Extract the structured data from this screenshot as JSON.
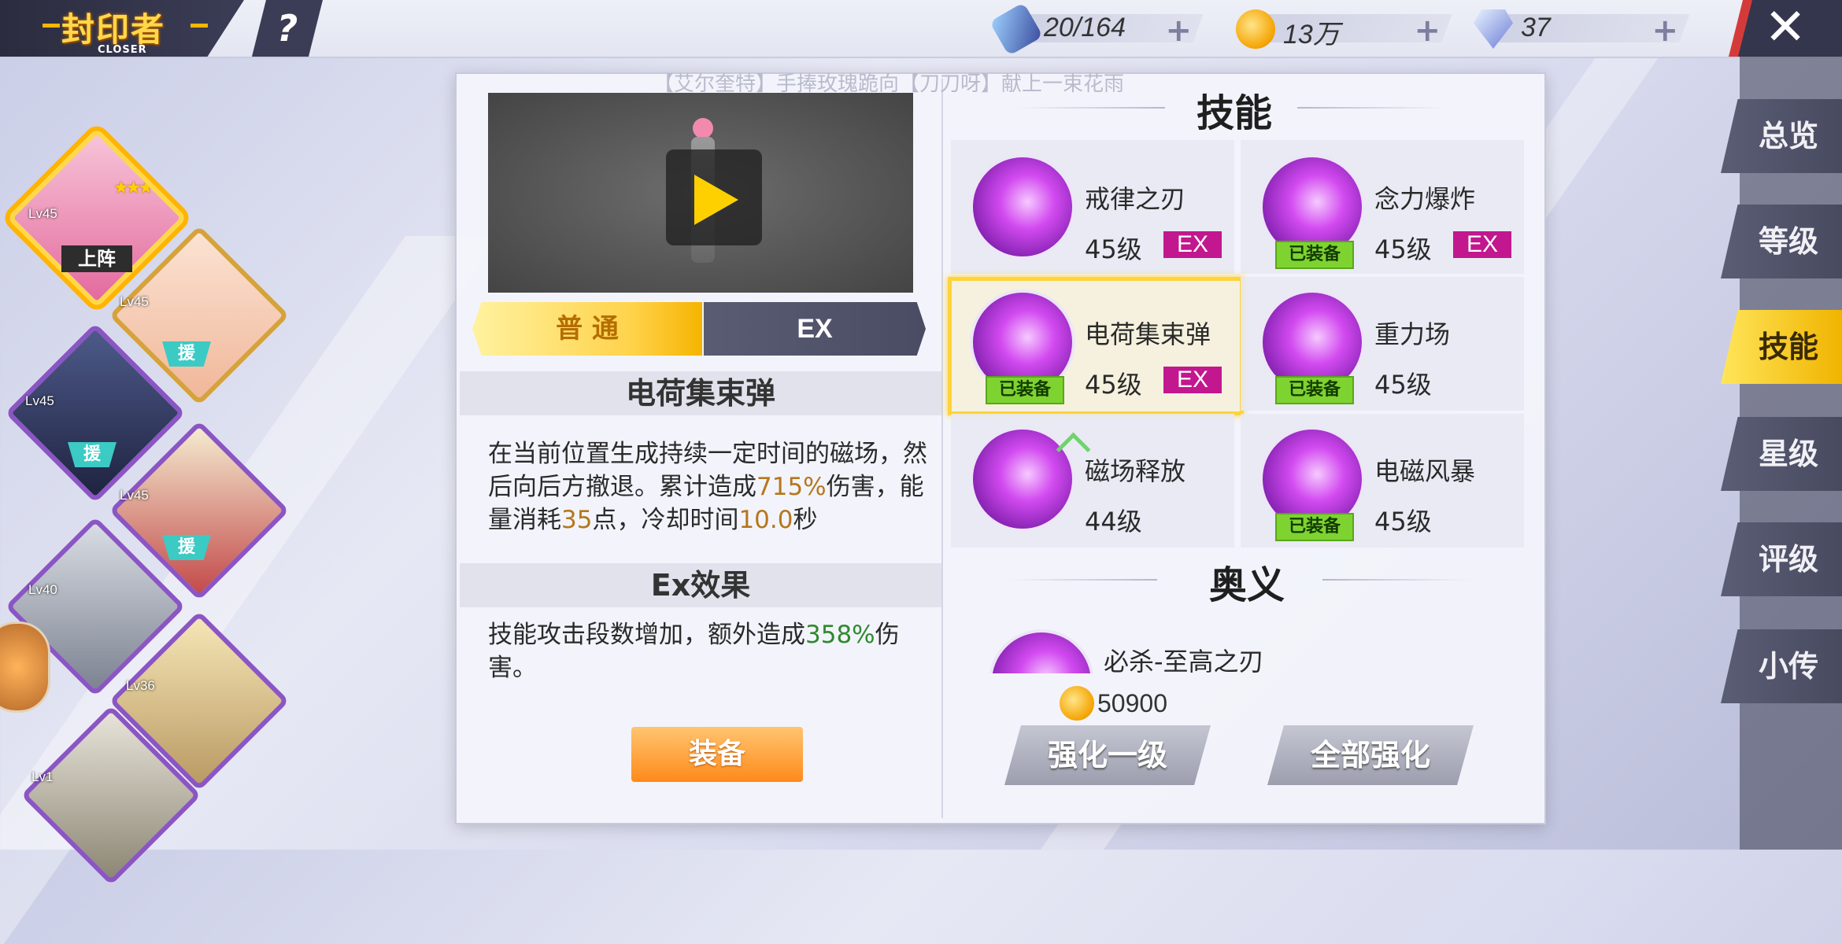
{
  "header": {
    "logo_main": "封印者",
    "logo_sub": "CLOSER",
    "help_label": "?",
    "close_label": "✕",
    "resources": [
      {
        "icon": "energy-canister-icon",
        "value": "20/164",
        "plus": "+"
      },
      {
        "icon": "gold-coin-icon",
        "value": "13万",
        "plus": "+"
      },
      {
        "icon": "diamond-icon",
        "value": "37",
        "plus": "+"
      }
    ]
  },
  "roster": [
    {
      "level": "Lv45",
      "badge": "上阵",
      "selected": true
    },
    {
      "level": "Lv45",
      "badge": "援"
    },
    {
      "level": "Lv45",
      "badge": "援"
    },
    {
      "level": "Lv45",
      "badge": "援"
    },
    {
      "level": "Lv40",
      "badge": ""
    },
    {
      "level": "Lv36",
      "badge": ""
    },
    {
      "level": "Lv1",
      "badge": ""
    }
  ],
  "side_nav": [
    "总览",
    "等级",
    "技能",
    "星级",
    "评级",
    "小传"
  ],
  "side_nav_active": "技能",
  "marquee": "【艾尔奎特】手捧玫瑰跪向【刀刀呀】献上一束花雨",
  "detail": {
    "mode_tabs": {
      "normal": "普 通",
      "ex": "EX"
    },
    "skill_title": "电荷集束弹",
    "desc_parts": [
      "在当前位置生成持续一定时间的磁场，然后向后方撤退。累计造成",
      "715%",
      "伤害，能量消耗",
      "35",
      "点，冷却时间",
      "10.0",
      "秒"
    ],
    "ex_title": "Ex效果",
    "ex_desc_parts": [
      "技能攻击段数增加，额外造成",
      "358%",
      "伤害。"
    ],
    "equip_label": "装备"
  },
  "skills_panel": {
    "title": "技能",
    "skills": [
      {
        "name": "戒律之刃",
        "level": "45级",
        "ex": "EX",
        "equipped": ""
      },
      {
        "name": "念力爆炸",
        "level": "45级",
        "ex": "EX",
        "equipped": "已装备"
      },
      {
        "name": "电荷集束弹",
        "level": "45级",
        "ex": "EX",
        "equipped": "已装备"
      },
      {
        "name": "重力场",
        "level": "45级",
        "ex": "",
        "equipped": "已装备"
      },
      {
        "name": "磁场释放",
        "level": "44级",
        "ex": "",
        "equipped": ""
      },
      {
        "name": "电磁风暴",
        "level": "45级",
        "ex": "",
        "equipped": "已装备"
      }
    ],
    "ultimate_title": "奥义",
    "ultimate_name": "必杀-至高之刃",
    "cost": "50900",
    "upgrade_one": "强化一级",
    "upgrade_all": "全部强化"
  },
  "colors": {
    "accent_gold": "#ffd33a",
    "ex_badge": "#c2178f",
    "equipped_green": "#7ed331",
    "equip_button": "#ff8a1a"
  }
}
